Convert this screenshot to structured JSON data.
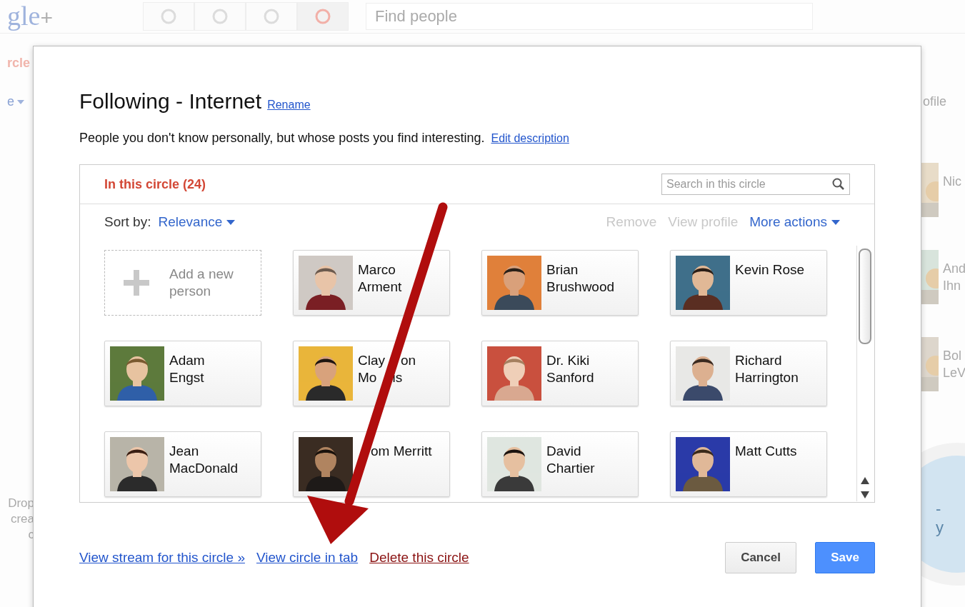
{
  "background": {
    "logo": {
      "letters": "gle",
      "plus": "+"
    },
    "search": {
      "placeholder": "Find people"
    },
    "toolbar_icons": [
      {
        "selected": false
      },
      {
        "selected": false
      },
      {
        "selected": false
      },
      {
        "selected": true
      }
    ],
    "left_tab": "rcle",
    "left_menu": "e",
    "right_actions": [
      "ofile"
    ],
    "people": [
      {
        "lines": [
          "Nic"
        ]
      },
      {
        "lines": [
          "And",
          "Ihn"
        ]
      },
      {
        "lines": [
          "Bol",
          "LeV"
        ]
      }
    ],
    "drop_zone": [
      "Drop",
      "crea",
      "c"
    ],
    "circle": [
      "-",
      "y"
    ]
  },
  "dialog": {
    "title": "Following - Internet",
    "rename": "Rename",
    "description": "People you don't know personally, but whose posts you find interesting.",
    "edit_description": "Edit description",
    "tab": {
      "label": "In this circle (24)",
      "selected": true
    },
    "search": {
      "placeholder": "Search in this circle"
    },
    "sort": {
      "label": "Sort by:",
      "value": "Relevance"
    },
    "actions": [
      {
        "label": "Remove",
        "disabled": true,
        "dropdown": false
      },
      {
        "label": "View profile",
        "disabled": true,
        "dropdown": false
      },
      {
        "label": "More actions",
        "disabled": false,
        "dropdown": true
      }
    ],
    "add_person": "Add a new person",
    "people": [
      {
        "lines": [
          [
            "Marco"
          ],
          [
            "Arment"
          ]
        ],
        "covered_start": false
      },
      {
        "lines": [
          [
            "Brian"
          ],
          [
            "Brushwood"
          ]
        ],
        "covered_start": false
      },
      {
        "lines": [
          [
            "Kevin Rose"
          ]
        ],
        "covered_start": false
      },
      {
        "lines": [
          [
            "Adam"
          ],
          [
            "Engst"
          ]
        ],
        "covered_start": false
      },
      {
        "lines": [
          [
            "Clay",
            "on"
          ],
          [
            "Mo",
            "is"
          ]
        ],
        "covered_start": false
      },
      {
        "lines": [
          [
            "Dr. Kiki"
          ],
          [
            "Sanford"
          ]
        ],
        "covered_start": false
      },
      {
        "lines": [
          [
            "Richard"
          ],
          [
            "Harrington"
          ]
        ],
        "covered_start": false
      },
      {
        "lines": [
          [
            "Jean"
          ],
          [
            "MacDonald"
          ]
        ],
        "covered_start": false
      },
      {
        "lines": [
          [
            "om Merritt"
          ]
        ],
        "covered_start": true
      },
      {
        "lines": [
          [
            "David"
          ],
          [
            "Chartier"
          ]
        ],
        "covered_start": false
      },
      {
        "lines": [
          [
            "Matt Cutts"
          ]
        ],
        "covered_start": false
      }
    ],
    "links": [
      {
        "label": "View stream for this circle »",
        "kind": "normal"
      },
      {
        "label": "View circle in tab",
        "kind": "normal"
      },
      {
        "label": "Delete this circle",
        "kind": "danger"
      }
    ],
    "buttons": [
      {
        "label": "Cancel",
        "kind": "secondary"
      },
      {
        "label": "Save",
        "kind": "primary"
      }
    ]
  }
}
